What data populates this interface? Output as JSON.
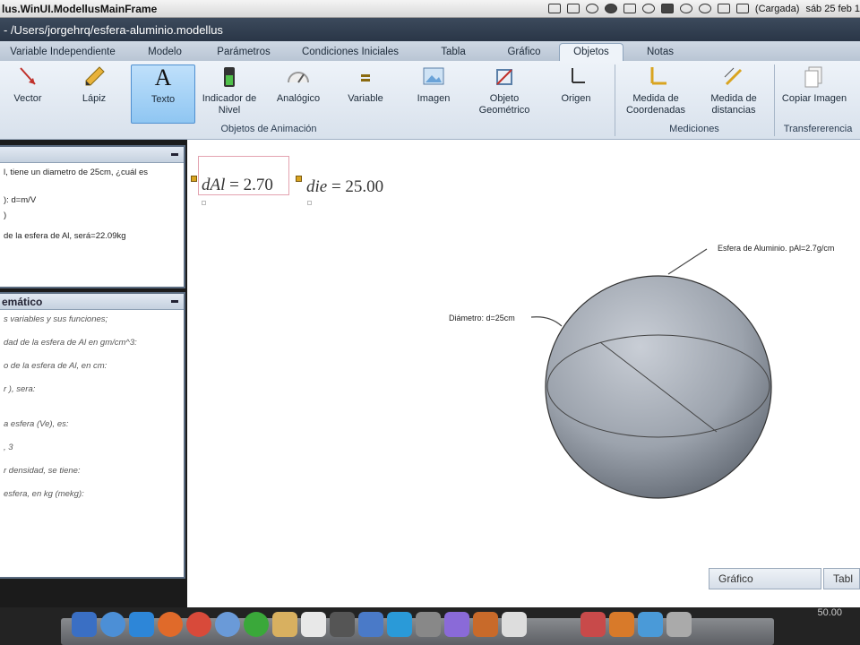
{
  "menubar": {
    "app_title": "lus.WinUI.ModellusMainFrame",
    "battery_text": "(Cargada)",
    "clock": "sáb 25 feb  1"
  },
  "window": {
    "title": "- /Users/jorgehrq/esfera-aluminio.modellus"
  },
  "tabs": [
    {
      "label": "Variable Independiente"
    },
    {
      "label": "Modelo"
    },
    {
      "label": "Parámetros"
    },
    {
      "label": "Condiciones Iniciales"
    },
    {
      "label": "Tabla"
    },
    {
      "label": "Gráfico"
    },
    {
      "label": "Objetos"
    },
    {
      "label": "Notas"
    }
  ],
  "ribbon": {
    "buttons": [
      {
        "label": "Vector",
        "icon": "vector-icon"
      },
      {
        "label": "Lápiz",
        "icon": "pencil-icon"
      },
      {
        "label": "Texto",
        "icon": "text-icon"
      },
      {
        "label": "Indicador de Nivel",
        "icon": "level-indicator-icon"
      },
      {
        "label": "Analógico",
        "icon": "analog-gauge-icon"
      },
      {
        "label": "Variable",
        "icon": "variable-icon"
      },
      {
        "label": "Imagen",
        "icon": "image-icon"
      },
      {
        "label": "Objeto Geométrico",
        "icon": "geometric-object-icon"
      },
      {
        "label": "Origen",
        "icon": "origin-icon"
      },
      {
        "label": "Medida de Coordenadas",
        "icon": "coordinates-icon"
      },
      {
        "label": "Medida de distancias",
        "icon": "distance-icon"
      },
      {
        "label": "Copiar Imagen",
        "icon": "copy-image-icon"
      }
    ],
    "groups": {
      "animation": "Objetos de Animación",
      "measurements": "Mediciones",
      "transfer": "Transfererencia"
    }
  },
  "notes_panel": {
    "lines": [
      "l, tiene un diametro de 25cm, ¿cuál es",
      "",
      "): d=m/V",
      ")",
      "de la esfera de Al, será=22.09kg"
    ]
  },
  "model_panel": {
    "title": "emático",
    "lines": [
      "s variables y sus funciones;",
      "dad de la esfera de Al en gm/cm^3:",
      "o de la esfera de Al, en cm:",
      "r ), sera:",
      "",
      "a esfera (Ve), es:",
      ", 3",
      "r densidad, se tiene:",
      "esfera, en kg (mekg):"
    ]
  },
  "canvas": {
    "expr1": {
      "var": "dAl",
      "value": "= 2.70"
    },
    "expr2": {
      "var": "die",
      "value": "= 25.00"
    },
    "sphere_label": "Esfera de Aluminio.  pAl=2.7g/cm",
    "diameter_label": "Diámetro:  d=25cm"
  },
  "bottom_tabs": {
    "grafico": "Gráfico",
    "tabla": "Tabl"
  },
  "bottom_status": "50.00"
}
